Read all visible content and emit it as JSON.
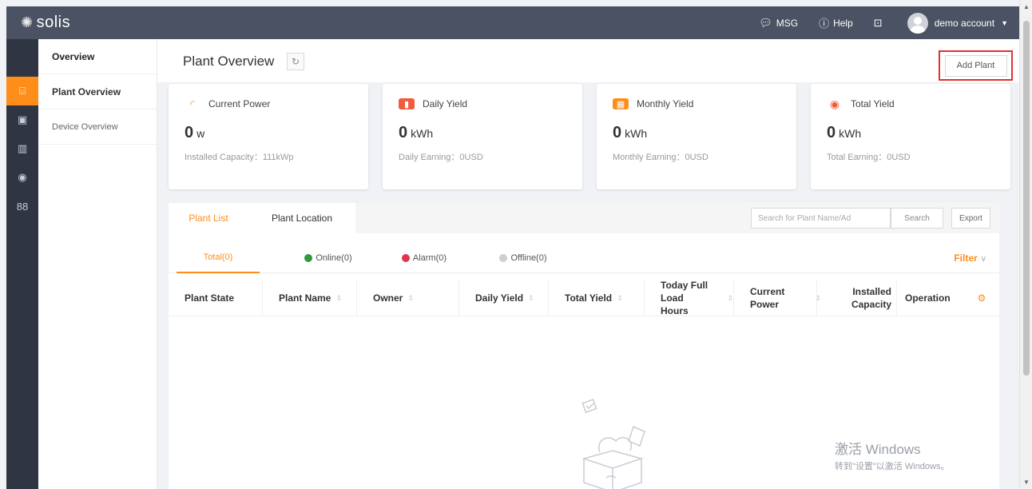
{
  "app": {
    "logo_text": "solis"
  },
  "topbar": {
    "msg_label": "MSG",
    "help_label": "Help",
    "user_name": "demo account"
  },
  "rail": {
    "icons": [
      "plant-icon",
      "device-icon",
      "report-icon",
      "monitor-icon",
      "apps-icon"
    ]
  },
  "sidebar": {
    "items": [
      {
        "label": "Overview"
      },
      {
        "label": "Plant Overview"
      },
      {
        "label": "Device Overview"
      }
    ]
  },
  "header": {
    "title": "Plant Overview",
    "add_plant_label": "Add Plant"
  },
  "cards": [
    {
      "title": "Current Power",
      "value": "0",
      "unit": "w",
      "sub": "Installed Capacity：111kWp",
      "color": "#ff8d1a"
    },
    {
      "title": "Daily Yield",
      "value": "0",
      "unit": "kWh",
      "sub": "Daily Earning：0USD",
      "color": "#f25c3c"
    },
    {
      "title": "Monthly Yield",
      "value": "0",
      "unit": "kWh",
      "sub": "Monthly Earning：0USD",
      "color": "#ff8d1a"
    },
    {
      "title": "Total Yield",
      "value": "0",
      "unit": "kWh",
      "sub": "Total Earning：0USD",
      "color": "#f25c3c"
    }
  ],
  "tabs": [
    {
      "label": "Plant List"
    },
    {
      "label": "Plant Location"
    }
  ],
  "search": {
    "placeholder": "Search for Plant Name/Ad",
    "button_label": "Search",
    "export_label": "Export"
  },
  "status_filters": [
    {
      "label": "Total(0)",
      "color": ""
    },
    {
      "label": "Online(0)",
      "color": "#2e9b3c"
    },
    {
      "label": "Alarm(0)",
      "color": "#e0344a"
    },
    {
      "label": "Offline(0)",
      "color": "#cfcfcf"
    }
  ],
  "filter_label": "Filter",
  "table": {
    "columns": [
      {
        "label": "Plant State"
      },
      {
        "label": "Plant Name"
      },
      {
        "label": "Owner"
      },
      {
        "label": "Daily Yield"
      },
      {
        "label": "Total Yield"
      },
      {
        "label_1": "Today Full",
        "label_2": "Load Hours"
      },
      {
        "label_1": "Current",
        "label_2": "Power"
      },
      {
        "label_1": "Installed",
        "label_2": "Capacity"
      },
      {
        "label": "Operation"
      }
    ]
  },
  "watermark": {
    "line1": "激活 Windows",
    "line2": "转到\"设置\"以激活 Windows。"
  }
}
